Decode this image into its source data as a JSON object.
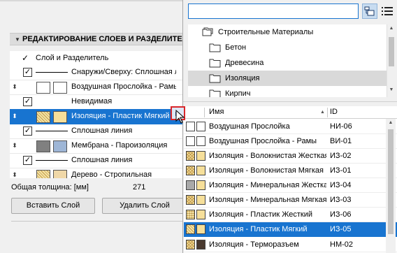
{
  "left_panel": {
    "section_title": "РЕДАКТИРОВАНИЕ СЛОЕВ И РАЗДЕЛИТЕЛЕЙ",
    "header_row": {
      "label": "Слой и Разделитель"
    },
    "rows": [
      {
        "kind": "line",
        "checked": true,
        "label": "Снаружи/Сверху: Сплошная линия"
      },
      {
        "kind": "layer",
        "swatch1": "#ffffff",
        "swatch2": "#ffffff",
        "label": "Воздушная Прослойка - Рамы"
      },
      {
        "kind": "line",
        "checked": true,
        "label": "Невидимая"
      },
      {
        "kind": "layer",
        "selected": true,
        "swatch1": "pattern",
        "swatch2": "#f6df9a",
        "label": "Изоляция - Пластик Мягкий"
      },
      {
        "kind": "line",
        "checked": true,
        "label": "Сплошная линия"
      },
      {
        "kind": "layer",
        "swatch1": "#808080",
        "swatch2": "#9eb6d6",
        "label": "Мембрана - Пароизоляция"
      },
      {
        "kind": "line",
        "checked": true,
        "label": "Сплошная линия"
      },
      {
        "kind": "layer",
        "swatch1": "pattern",
        "swatch2": "#f0d8a8",
        "label": "Дерево - Стропильная"
      }
    ],
    "total_label": "Общая толщина: [мм]",
    "total_value": "271",
    "insert_button": "Вставить Слой",
    "delete_button": "Удалить Слой"
  },
  "popup": {
    "search": {
      "value": "",
      "placeholder": ""
    },
    "tree": [
      {
        "label": "Строительные Материалы",
        "level": 0
      },
      {
        "label": "Бетон",
        "level": 1
      },
      {
        "label": "Древесина",
        "level": 1
      },
      {
        "label": "Изоляция",
        "level": 1,
        "selected": true
      },
      {
        "label": "Кирпич",
        "level": 1
      }
    ],
    "columns": {
      "name": "Имя",
      "id": "ID"
    },
    "rows": [
      {
        "name": "Воздушная Прослойка",
        "id": "НИ-06",
        "c1": "#ffffff",
        "c2": "#ffffff"
      },
      {
        "name": "Воздушная Прослойка - Рамы",
        "id": "ВИ-01",
        "c1": "#ffffff",
        "c2": "#ffffff"
      },
      {
        "name": "Изоляция - Волокнистая Жесткая",
        "id": "ИЗ-02",
        "c1": "mesh",
        "c2": "#f6df9a"
      },
      {
        "name": "Изоляция - Волокнистая Мягкая",
        "id": "ИЗ-01",
        "c1": "mesh",
        "c2": "#f6df9a"
      },
      {
        "name": "Изоляция - Минеральная Жесткая",
        "id": "ИЗ-04",
        "c1": "#a9a9a9",
        "c2": "#f6df9a"
      },
      {
        "name": "Изоляция - Минеральная Мягкая",
        "id": "ИЗ-03",
        "c1": "mesh",
        "c2": "#f6df9a"
      },
      {
        "name": "Изоляция - Пластик Жесткий",
        "id": "ИЗ-06",
        "c1": "dots",
        "c2": "#f6df9a"
      },
      {
        "name": "Изоляция - Пластик Мягкий",
        "id": "ИЗ-05",
        "c1": "hatch",
        "c2": "#f6df9a",
        "selected": true
      },
      {
        "name": "Изоляция - Терморазъем",
        "id": "НМ-02",
        "c1": "mesh",
        "c2": "#4a3a30"
      }
    ]
  }
}
